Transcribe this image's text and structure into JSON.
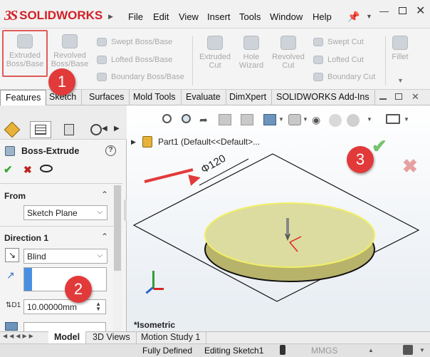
{
  "app": {
    "brand_ds": "3S",
    "brand_name": "SOLIDWORKS"
  },
  "menu": [
    "File",
    "Edit",
    "View",
    "Insert",
    "Tools",
    "Window",
    "Help"
  ],
  "command_manager": {
    "extruded": "Extruded\nBoss/Base",
    "revolved": "Revolved\nBoss/Base",
    "swept_boss": "Swept Boss/Base",
    "lofted_boss": "Lofted Boss/Base",
    "boundary_boss": "Boundary Boss/Base",
    "extruded_cut": "Extruded\nCut",
    "hole_wizard": "Hole\nWizard",
    "revolved_cut": "Revolved\nCut",
    "swept_cut": "Swept Cut",
    "lofted_cut": "Lofted Cut",
    "boundary_cut": "Boundary Cut",
    "fillet": "Fillet"
  },
  "tabs": [
    "Features",
    "Sketch",
    "Surfaces",
    "Mold Tools",
    "Evaluate",
    "DimXpert",
    "SOLIDWORKS Add-Ins"
  ],
  "property_manager": {
    "title": "Boss-Extrude",
    "from_label": "From",
    "from_value": "Sketch Plane",
    "direction_label": "Direction 1",
    "end_condition": "Blind",
    "depth": "10.00000mm"
  },
  "tree": {
    "part_label": "Part1  (Default<<Default>..."
  },
  "graphics": {
    "dimension": "Φ120",
    "view_label": "*Isometric"
  },
  "callouts": [
    "1",
    "2",
    "3"
  ],
  "bottom_tabs": [
    "Model",
    "3D Views",
    "Motion Study 1"
  ],
  "status": {
    "defined": "Fully Defined",
    "editing": "Editing Sketch1",
    "units": "MMGS"
  },
  "colors": {
    "accent_red": "#e23a3a",
    "brand_red": "#d22027",
    "ok_green": "#3aa935"
  }
}
